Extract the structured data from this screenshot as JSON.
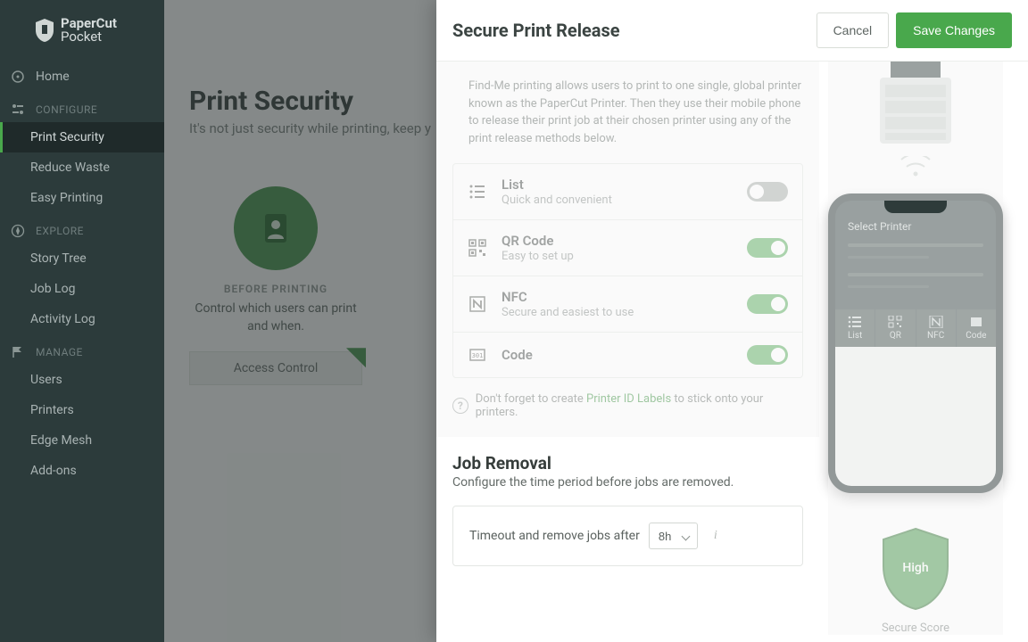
{
  "brand": {
    "name_top": "PaperCut",
    "name_bottom": "Pocket"
  },
  "sidebar": {
    "home": "Home",
    "sections": {
      "configure": {
        "label": "CONFIGURE",
        "items": [
          "Print Security",
          "Reduce Waste",
          "Easy Printing"
        ],
        "active_index": 0
      },
      "explore": {
        "label": "EXPLORE",
        "items": [
          "Story Tree",
          "Job Log",
          "Activity Log"
        ]
      },
      "manage": {
        "label": "MANAGE",
        "items": [
          "Users",
          "Printers",
          "Edge Mesh",
          "Add-ons"
        ]
      }
    }
  },
  "page": {
    "title": "Print Security",
    "subtitle": "It's not just security while printing, keep y",
    "card": {
      "before_label": "BEFORE PRINTING",
      "desc": "Control which users can print and when.",
      "button": "Access Control"
    }
  },
  "modal": {
    "title": "Secure Print Release",
    "cancel": "Cancel",
    "save": "Save Changes",
    "intro": "Find-Me printing allows users to print to one single, global printer known as the PaperCut Printer. Then they use their mobile phone to release their print job at their chosen printer using any of the print release methods below.",
    "methods": [
      {
        "id": "list",
        "title": "List",
        "sub": "Quick and convenient",
        "on": false
      },
      {
        "id": "qr",
        "title": "QR Code",
        "sub": "Easy to set up",
        "on": true
      },
      {
        "id": "nfc",
        "title": "NFC",
        "sub": "Secure and easiest to use",
        "on": true
      },
      {
        "id": "code",
        "title": "Code",
        "sub": "",
        "on": true
      }
    ],
    "tip_prefix": "Don't forget to create ",
    "tip_link": "Printer ID Labels",
    "tip_suffix": " to stick onto your printers.",
    "job_removal": {
      "title": "Job Removal",
      "sub": "Configure the time period before jobs are removed.",
      "label": "Timeout and remove jobs after",
      "value": "8h"
    }
  },
  "phone": {
    "title": "Select Printer",
    "tabs": [
      "List",
      "QR",
      "NFC",
      "Code"
    ]
  },
  "score": {
    "level": "High",
    "label": "Secure Score"
  }
}
